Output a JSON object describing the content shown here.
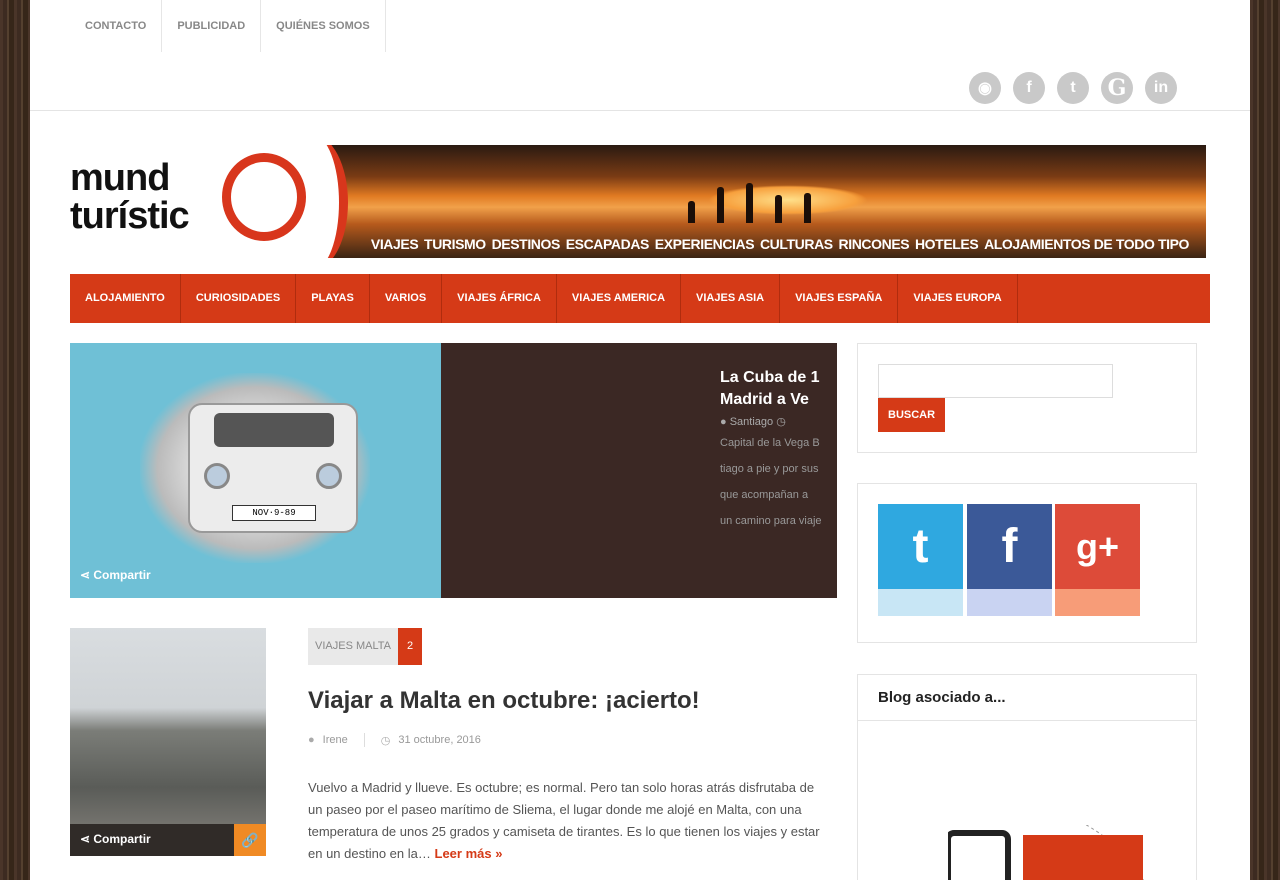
{
  "topnav": [
    "CONTACTO",
    "PUBLICIDAD",
    "QUIÉNES SOMOS"
  ],
  "social_icons": [
    {
      "icon": "rss-icon",
      "glyph": "◉"
    },
    {
      "icon": "facebook-icon",
      "glyph": "f"
    },
    {
      "icon": "twitter-icon",
      "glyph": "t"
    },
    {
      "icon": "google-icon",
      "glyph": "G"
    },
    {
      "icon": "linkedin-icon",
      "glyph": "in"
    }
  ],
  "logo": {
    "line1": "mund",
    "line2": "turístic"
  },
  "tagline": [
    "VIAJES",
    "TURISMO",
    "DESTINOS",
    "ESCAPADAS",
    "EXPERIENCIAS",
    "CULTURAS",
    "RINCONES",
    "HOTELES",
    "ALOJAMIENTOS DE TODO TIPO"
  ],
  "catnav": [
    "ALOJAMIENTO",
    "CURIOSIDADES",
    "PLAYAS",
    "VARIOS",
    "VIAJES ÁFRICA",
    "VIAJES AMERICA",
    "VIAJES ASIA",
    "VIAJES ESPAÑA",
    "VIAJES EUROPA"
  ],
  "slider": {
    "share_label": "Compartir",
    "plate": "NOV·9-89",
    "title_line1": "La Cuba de 1",
    "title_line2": "Madrid a Ve",
    "author": "Santiago",
    "excerpt": [
      "Capital de la Vega B",
      "tiago a pie y por sus",
      "que acompañan a",
      "un camino para viaje"
    ]
  },
  "post": {
    "category": "VIAJES MALTA",
    "comments": "2",
    "title": "Viajar a Malta en octubre: ¡acierto!",
    "author": "Irene",
    "date": "31 octubre, 2016",
    "excerpt": "Vuelvo a Madrid y llueve. Es octubre; es normal. Pero tan solo horas atrás disfrutaba de un paseo por el paseo marítimo de Sliema, el lugar donde me alojé en Malta, con una temperatura de unos 25 grados y camiseta de tirantes. Es lo que tienen los viajes y estar en un destino en la…",
    "read_more": "Leer más »",
    "share_label": "Compartir"
  },
  "sidebar": {
    "search_button": "BUSCAR",
    "social": [
      {
        "name": "twitter",
        "glyph": "t",
        "top": "#2fa8e0",
        "bottom": "#c8e6f5"
      },
      {
        "name": "facebook",
        "glyph": "f",
        "top": "#3b5998",
        "bottom": "#c9d3f2"
      },
      {
        "name": "google-plus",
        "glyph": "g+",
        "top": "#dd4b39",
        "bottom": "#f79c78"
      }
    ],
    "blog_title": "Blog asociado a..."
  },
  "colors": {
    "accent": "#d53a17"
  }
}
